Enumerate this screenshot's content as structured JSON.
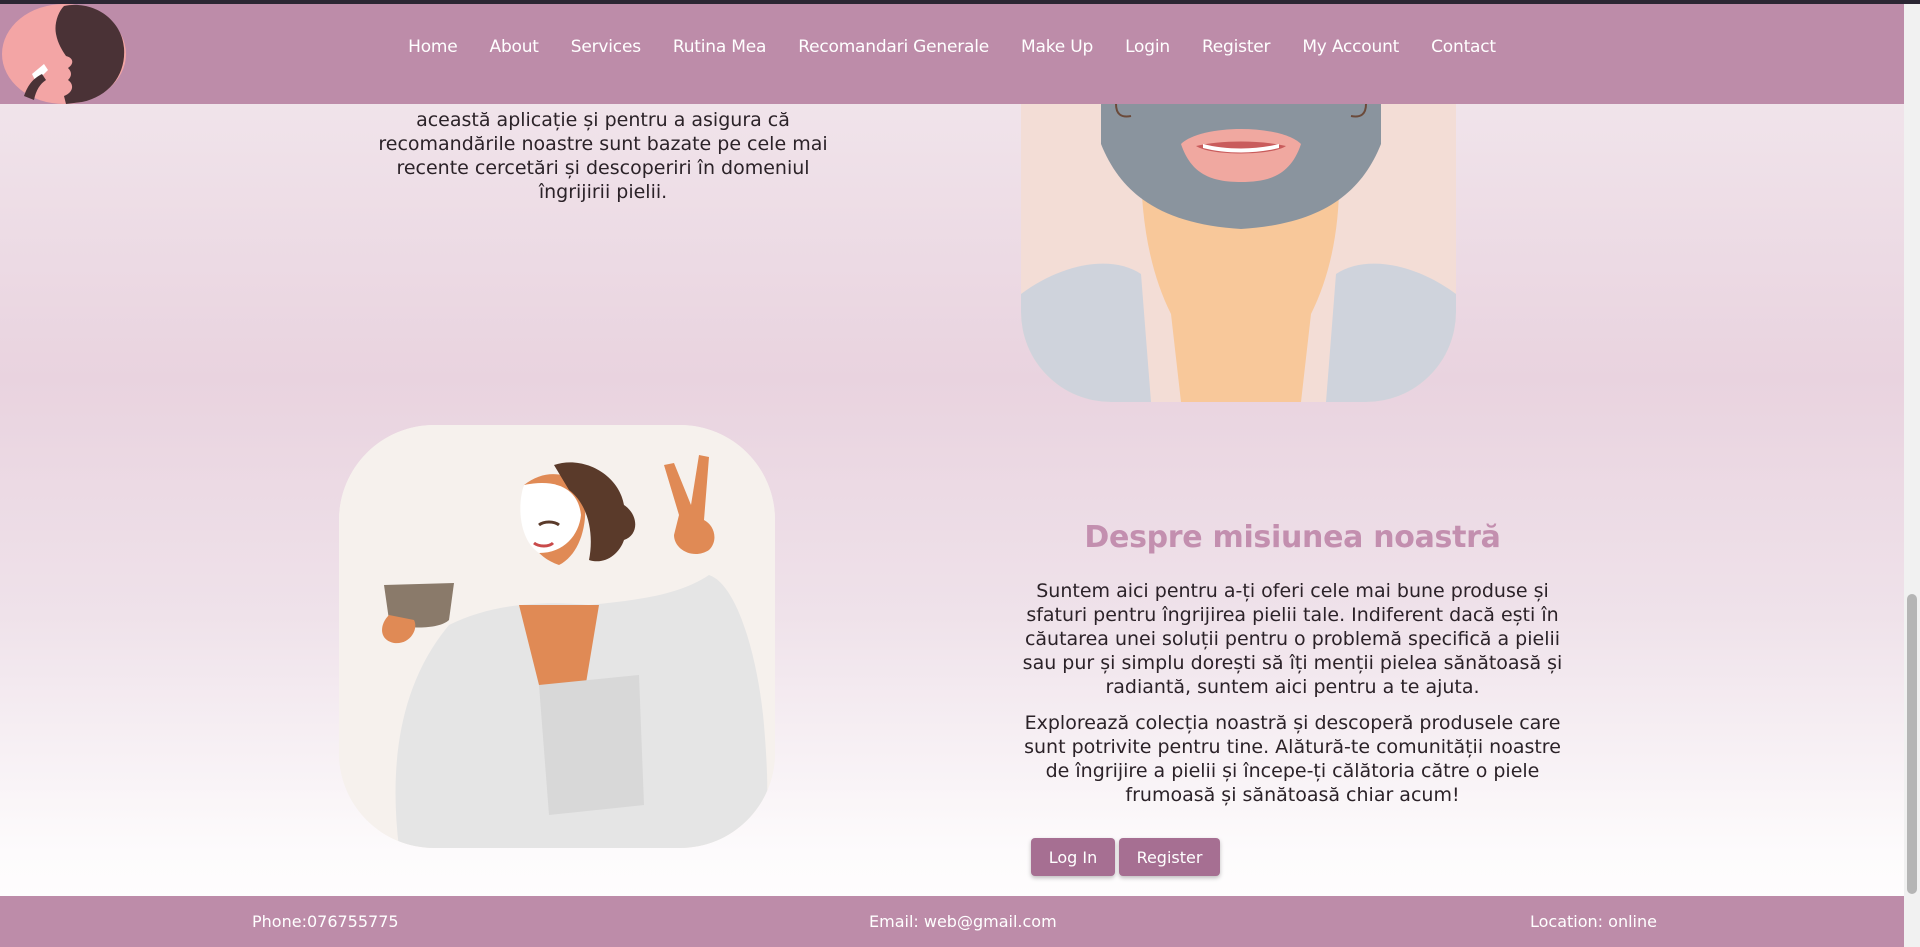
{
  "nav": {
    "items": [
      "Home",
      "About",
      "Services",
      "Rutina Mea",
      "Recomandari Generale",
      "Make Up",
      "Login",
      "Register",
      "My Account",
      "Contact"
    ]
  },
  "intro": {
    "text": "această aplicație și pentru a asigura că recomandările noastre sunt bazate pe cele mai recente cercetări și descoperiri în domeniul îngrijirii pielii."
  },
  "mission": {
    "title": "Despre misiunea noastră",
    "paragraph1": "Suntem aici pentru a-ți oferi cele mai bune produse și sfaturi pentru îngrijirea pielii tale. Indiferent dacă ești în căutarea unei soluții pentru o problemă specifică a pielii sau pur și simplu dorești să îți menții pielea sănătoasă și radiantă, suntem aici pentru a te ajuta.",
    "paragraph2": "Explorează colecția noastră și descoperă produsele care sunt potrivite pentru tine. Alătură-te comunității noastre de îngrijire a pielii și începe-ți călătoria către o piele frumoasă și sănătoasă chiar acum!",
    "login_label": "Log In",
    "register_label": "Register"
  },
  "footer": {
    "phone": "Phone:076755775",
    "email": "Email: web@gmail.com",
    "location": "Location: online"
  },
  "colors": {
    "brand": "#bd8ca9",
    "button": "#a66f92",
    "heading": "#c38faf"
  }
}
